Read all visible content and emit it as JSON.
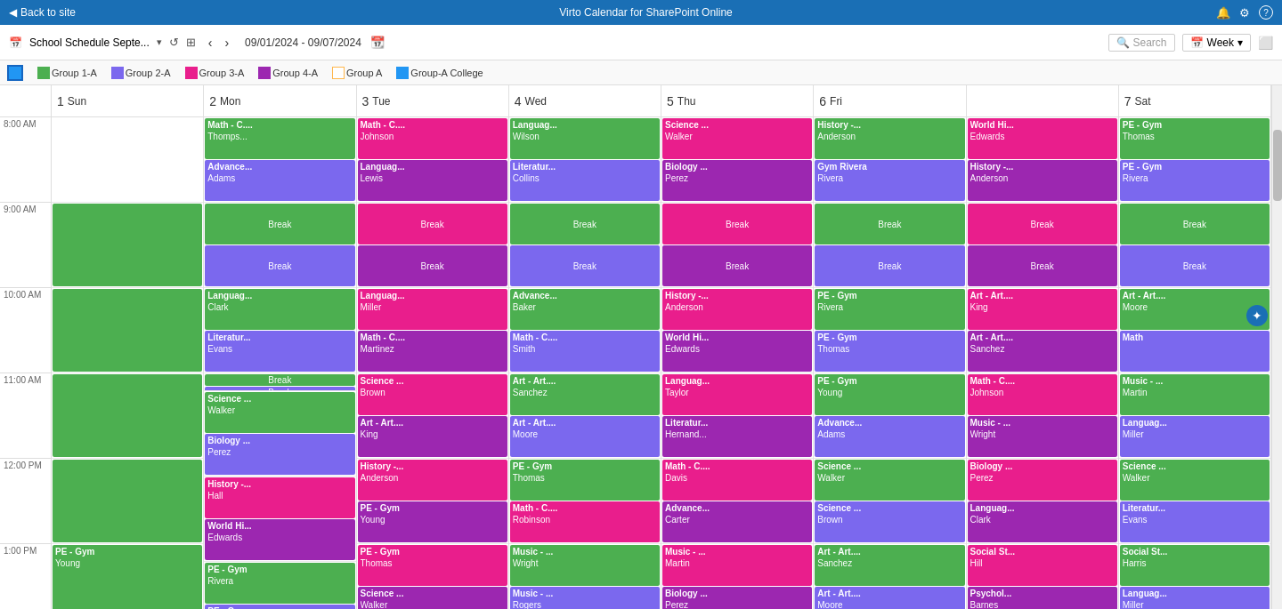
{
  "topbar": {
    "back_label": "Back to site",
    "title": "Virto Calendar for SharePoint Online",
    "bell_icon": "🔔",
    "gear_icon": "⚙",
    "help_icon": "?"
  },
  "toolbar": {
    "cal_icon": "📅",
    "cal_name": "School Schedule Septe...",
    "refresh_icon": "↺",
    "grid_icon": "⊞",
    "prev_icon": "‹",
    "next_icon": "›",
    "date_range": "09/01/2024 - 09/07/2024",
    "cal_small_icon": "📆",
    "search_placeholder": "Search",
    "week_label": "Week",
    "chevron_down": "▾",
    "maximize_icon": "⬜"
  },
  "legend": {
    "items": [
      {
        "id": "g1a",
        "label": "Group 1-A",
        "color": "#4caf50"
      },
      {
        "id": "g2a",
        "label": "Group 2-A",
        "color": "#7b68ee"
      },
      {
        "id": "g3a",
        "label": "Group 3-A",
        "color": "#e91e8c"
      },
      {
        "id": "g4a",
        "label": "Group 4-A",
        "color": "#9c27b0"
      },
      {
        "id": "ga",
        "label": "Group A",
        "color": "#ffb74d",
        "outline": true
      },
      {
        "id": "gac",
        "label": "Group-A College",
        "color": "#2196f3"
      }
    ]
  },
  "days": [
    {
      "num": "1",
      "name": "Sun"
    },
    {
      "num": "2",
      "name": "Mon"
    },
    {
      "num": "3",
      "name": "Tue"
    },
    {
      "num": "4",
      "name": "Wed"
    },
    {
      "num": "5",
      "name": "Thu"
    },
    {
      "num": "6",
      "name": "Fri"
    },
    {
      "num": "7",
      "name": "Sat"
    }
  ],
  "time_slots": [
    "8:00 AM",
    "9:00 AM",
    "10:00 AM",
    "11:00 AM",
    "12:00 PM",
    "1:00 PM"
  ],
  "grid": {
    "sun": {
      "bands": [
        [],
        [
          {
            "title": "",
            "teacher": "",
            "color": "g1a",
            "break": false
          }
        ],
        [],
        [],
        [],
        [
          {
            "title": "PE - Gym",
            "teacher": "Young",
            "color": "g1a",
            "break": false
          }
        ]
      ]
    }
  }
}
